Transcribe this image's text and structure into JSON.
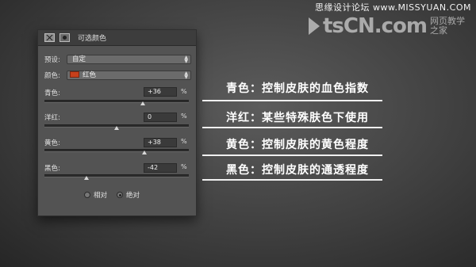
{
  "watermark": {
    "top_text": "思缘设计论坛 www.MISSYUAN.COM",
    "brand": "tsCN.com",
    "sub1": "网页教学",
    "sub2": "之家"
  },
  "panel": {
    "title": "可选颜色",
    "preset_label": "预设:",
    "preset_value": "自定",
    "colors_label": "颜色:",
    "colors_value": "红色",
    "swatch_color": "#c7401b",
    "sliders": [
      {
        "label": "青色:",
        "value": "+36",
        "unit": "%",
        "level": 0.68
      },
      {
        "label": "洋红:",
        "value": "0",
        "unit": "%",
        "level": 0.5
      },
      {
        "label": "黄色:",
        "value": "+38",
        "unit": "%",
        "level": 0.69
      },
      {
        "label": "黑色:",
        "value": "-42",
        "unit": "%",
        "level": 0.29
      }
    ],
    "method_relative": "相对",
    "method_absolute": "绝对",
    "selected_method": "absolute"
  },
  "notes": [
    "青色：控制皮肤的血色指数",
    "洋红：某些特殊肤色下使用",
    "黄色：控制皮肤的黄色程度",
    "黑色：控制皮肤的通透程度"
  ]
}
